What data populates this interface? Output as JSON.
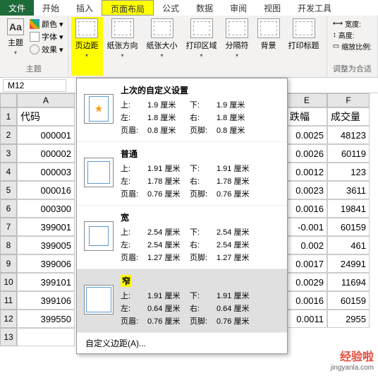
{
  "menubar": {
    "file": "文件",
    "tabs": [
      "开始",
      "插入",
      "页面布局",
      "公式",
      "数据",
      "审阅",
      "视图",
      "开发工具"
    ],
    "active_index": 2
  },
  "ribbon": {
    "theme": {
      "main": "主题",
      "color": "颜色",
      "font": "字体",
      "effect": "效果",
      "label": "主题"
    },
    "page": {
      "margins": "页边距",
      "orientation": "纸张方向",
      "size": "纸张大小",
      "print_area": "打印区域",
      "breaks": "分隔符",
      "background": "背景",
      "titles": "打印标题"
    },
    "scale": {
      "width": "宽度:",
      "height": "高度:",
      "scale": "缩放比例:",
      "label": "调整为合适"
    }
  },
  "namebox": "M12",
  "dropdown": {
    "last": {
      "title": "上次的自定义设置",
      "top_l": "上:",
      "top_v": "1.9 厘米",
      "bottom_l": "下:",
      "bottom_v": "1.9 厘米",
      "left_l": "左:",
      "left_v": "1.8 厘米",
      "right_l": "右:",
      "right_v": "1.8 厘米",
      "header_l": "页眉:",
      "header_v": "0.8 厘米",
      "footer_l": "页脚:",
      "footer_v": "0.8 厘米"
    },
    "normal": {
      "title": "普通",
      "top_l": "上:",
      "top_v": "1.91 厘米",
      "bottom_l": "下:",
      "bottom_v": "1.91 厘米",
      "left_l": "左:",
      "left_v": "1.78 厘米",
      "right_l": "右:",
      "right_v": "1.78 厘米",
      "header_l": "页眉:",
      "header_v": "0.76 厘米",
      "footer_l": "页脚:",
      "footer_v": "0.76 厘米"
    },
    "wide": {
      "title": "宽",
      "top_l": "上:",
      "top_v": "2.54 厘米",
      "bottom_l": "下:",
      "bottom_v": "2.54 厘米",
      "left_l": "左:",
      "left_v": "2.54 厘米",
      "right_l": "右:",
      "right_v": "2.54 厘米",
      "header_l": "页眉:",
      "header_v": "1.27 厘米",
      "footer_l": "页脚:",
      "footer_v": "1.27 厘米"
    },
    "narrow": {
      "title": "窄",
      "top_l": "上:",
      "top_v": "1.91 厘米",
      "bottom_l": "下:",
      "bottom_v": "1.91 厘米",
      "left_l": "左:",
      "left_v": "0.64 厘米",
      "right_l": "右:",
      "right_v": "0.64 厘米",
      "header_l": "页眉:",
      "header_v": "0.76 厘米",
      "footer_l": "页脚:",
      "footer_v": "0.76 厘米"
    },
    "custom": "自定义边距(A)..."
  },
  "grid": {
    "col_headers": [
      "A",
      "E",
      "F"
    ],
    "row_headers": [
      "1",
      "2",
      "3",
      "4",
      "5",
      "6",
      "7",
      "8",
      "9",
      "10",
      "11",
      "12",
      "13"
    ],
    "header_row": {
      "A": "代码",
      "E": "跌幅",
      "F": "成交量"
    },
    "rows": [
      {
        "A": "000001",
        "E": "0.0025",
        "F": "48123"
      },
      {
        "A": "000002",
        "E": "0.0026",
        "F": "60119"
      },
      {
        "A": "000003",
        "E": "0.0012",
        "F": "123"
      },
      {
        "A": "000016",
        "E": "0.0023",
        "F": "3611"
      },
      {
        "A": "000300",
        "E": "0.0016",
        "F": "19841"
      },
      {
        "A": "399001",
        "E": "-0.001",
        "F": "60159"
      },
      {
        "A": "399005",
        "E": "0.002",
        "F": "461"
      },
      {
        "A": "399006",
        "E": "0.0017",
        "F": "24991"
      },
      {
        "A": "399101",
        "E": "0.0029",
        "F": "11694"
      },
      {
        "A": "399106",
        "E": "0.0016",
        "F": "60159"
      },
      {
        "A": "399550",
        "E": "0.0011",
        "F": "2955"
      }
    ]
  },
  "watermark": {
    "logo": "经验啦",
    "url": "jingyanla.com"
  }
}
